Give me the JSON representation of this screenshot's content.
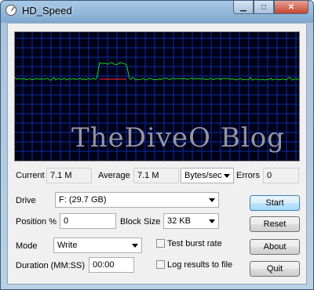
{
  "window": {
    "title": "HD_Speed",
    "minimize_icon": "minimize-icon",
    "maximize_icon": "maximize-icon",
    "close_icon": "close-icon"
  },
  "graph": {
    "watermark": "TheDiveO Blog",
    "colors": {
      "background": "#000018",
      "grid": "#0b2fa0",
      "line": "#22cc22",
      "average": "#dd2222"
    }
  },
  "stats": {
    "current_label": "Current",
    "current_value": "7.1 M",
    "average_label": "Average",
    "average_value": "7.1 M",
    "unit": "Bytes/sec",
    "errors_label": "Errors",
    "errors_value": "0"
  },
  "form": {
    "drive_label": "Drive",
    "drive_value": "F: (29.7 GB)",
    "position_label": "Position %",
    "position_value": "0",
    "block_size_label": "Block Size",
    "block_size_value": "32 KB",
    "mode_label": "Mode",
    "mode_value": "Write",
    "test_burst_label": "Test burst rate",
    "test_burst_checked": false,
    "duration_label": "Duration (MM:SS)",
    "duration_value": "00:00",
    "log_label": "Log results to file",
    "log_checked": false
  },
  "buttons": {
    "start": "Start",
    "reset": "Reset",
    "about": "About",
    "quit": "Quit"
  }
}
